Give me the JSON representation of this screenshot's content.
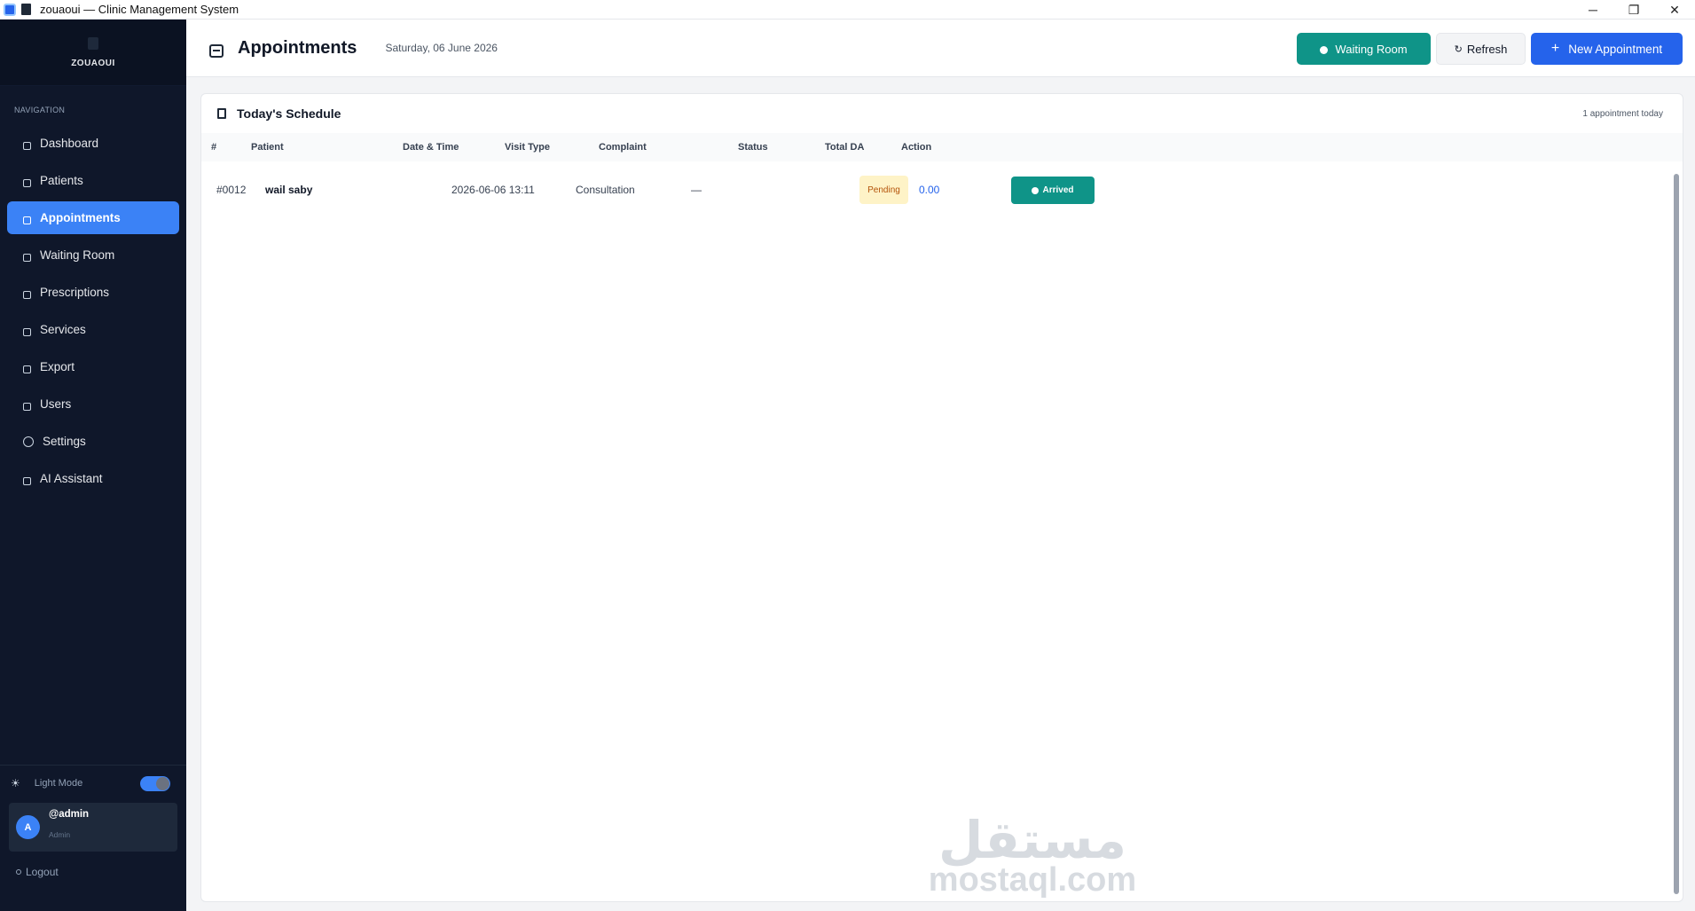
{
  "window": {
    "app_name": "zouaoui",
    "separator": "—",
    "subtitle": "Clinic Management System",
    "controls": {
      "minimize": "─",
      "maximize": "❐",
      "close": "✕"
    }
  },
  "sidebar": {
    "brand": "ZOUAOUI",
    "nav_header": "NAVIGATION",
    "items": [
      {
        "label": "Dashboard",
        "icon": "home-icon"
      },
      {
        "label": "Patients",
        "icon": "person-icon"
      },
      {
        "label": "Appointments",
        "icon": "calendar-icon",
        "active": true
      },
      {
        "label": "Waiting Room",
        "icon": "clock-icon"
      },
      {
        "label": "Prescriptions",
        "icon": "document-icon"
      },
      {
        "label": "Services",
        "icon": "tool-icon"
      },
      {
        "label": "Export",
        "icon": "export-icon"
      },
      {
        "label": "Users",
        "icon": "users-icon"
      },
      {
        "label": "Settings",
        "icon": "gear-icon"
      },
      {
        "label": "AI Assistant",
        "icon": "robot-icon"
      }
    ],
    "theme_label": "Light Mode",
    "theme_icon": "☀",
    "user": {
      "initial": "A",
      "username": "@admin",
      "role": "Admin"
    },
    "logout_label": "Logout"
  },
  "header": {
    "title": "Appointments",
    "date": "Saturday, 06 June 2026",
    "buttons": {
      "waiting_room": "Waiting Room",
      "refresh": "Refresh",
      "refresh_icon": "↻",
      "new_appointment": "New Appointment",
      "new_icon": "+"
    }
  },
  "schedule": {
    "title": "Today's Schedule",
    "count": "1 appointment today",
    "columns": [
      "#",
      "Patient",
      "Date & Time",
      "Visit Type",
      "Complaint",
      "Status",
      "Total DA",
      "Action"
    ],
    "rows": [
      {
        "id": "#0012",
        "patient": "wail saby",
        "datetime": "2026-06-06  13:11",
        "visit_type": "Consultation",
        "complaint": "—",
        "status": "Pending",
        "total": "0.00",
        "action": "Arrived"
      }
    ]
  },
  "watermark": {
    "arabic": "مستقل",
    "latin": "mostaql.com"
  },
  "colors": {
    "sidebar_bg": "#0f172a",
    "accent": "#3b82f6",
    "teal": "#0f9488",
    "pending_bg": "#fef3c7",
    "pending_text": "#b45309"
  }
}
